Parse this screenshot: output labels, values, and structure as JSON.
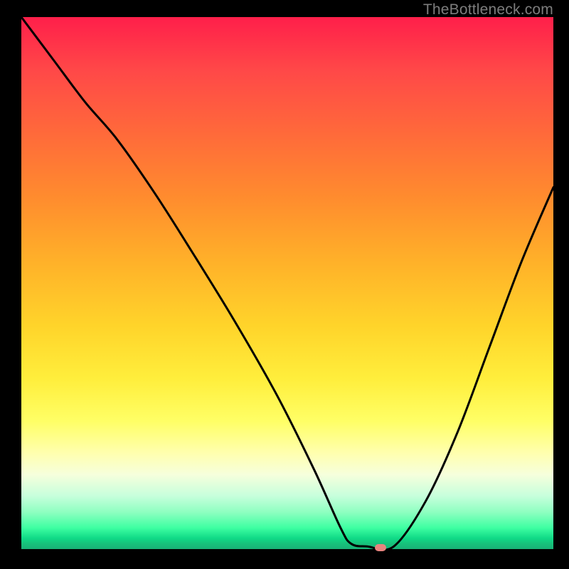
{
  "watermark": "TheBottleneck.com",
  "chart_data": {
    "type": "line",
    "title": "",
    "xlabel": "",
    "ylabel": "",
    "ylim": [
      0,
      100
    ],
    "xlim": [
      0,
      100
    ],
    "x": [
      0,
      6,
      12,
      18,
      25,
      32,
      40,
      48,
      55,
      60,
      62,
      65,
      70,
      76,
      82,
      88,
      94,
      100
    ],
    "values": [
      100,
      92,
      84,
      77,
      67,
      56,
      43,
      29,
      15,
      4,
      1,
      0.5,
      0.5,
      9,
      22,
      38,
      54,
      68
    ],
    "marker": {
      "x": 67.5,
      "y": 0.3
    },
    "gradient_stops": [
      {
        "pos": 0,
        "color": "#ff1f4a"
      },
      {
        "pos": 22,
        "color": "#ff6a3a"
      },
      {
        "pos": 46,
        "color": "#ffb129"
      },
      {
        "pos": 68,
        "color": "#ffee3c"
      },
      {
        "pos": 82,
        "color": "#ffffaf"
      },
      {
        "pos": 93,
        "color": "#8fffc1"
      },
      {
        "pos": 100,
        "color": "#19b276"
      }
    ]
  }
}
